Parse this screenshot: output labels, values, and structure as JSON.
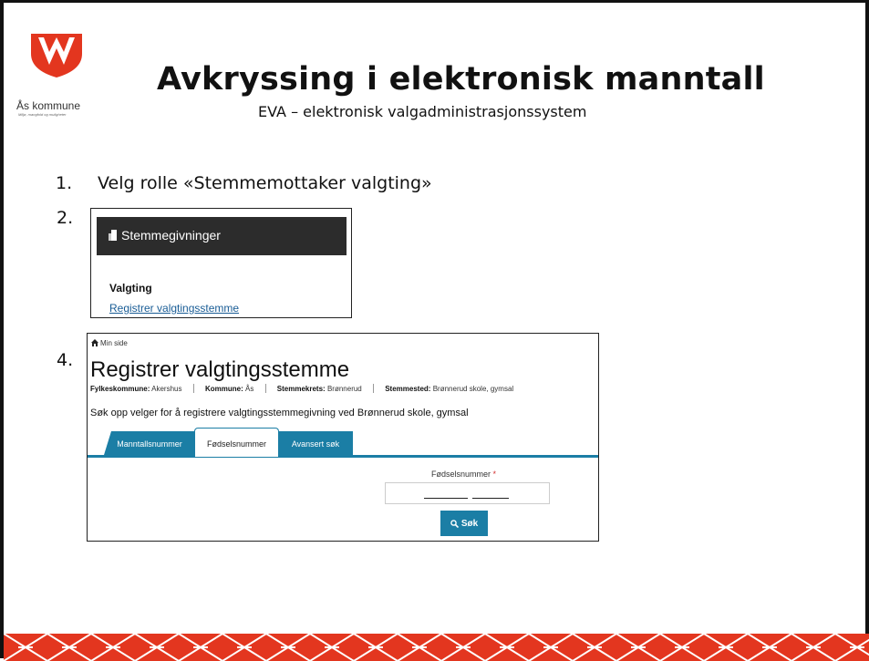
{
  "colors": {
    "accent": "#1b7ea5",
    "band": "#e3361f",
    "dark_bar": "#2c2c2c",
    "link": "#1a5d96"
  },
  "logo": {
    "name": "Ås kommune",
    "tagline": "Miljø, mangfold og muligheter",
    "icon": "coat-of-arms-icon"
  },
  "header": {
    "title": "Avkryssing i elektronisk manntall",
    "subtitle": "EVA – elektronisk valgadministrasjonssystem"
  },
  "steps": {
    "step1": {
      "number": "1.",
      "text": "Velg rolle «Stemmemottaker valgting»"
    },
    "step2": {
      "number": "2."
    },
    "step4": {
      "number": "4."
    }
  },
  "screenshot2": {
    "bar_title": "Stemmegivninger",
    "bar_icon": "ballot-icon",
    "section": "Valgting",
    "link": "Registrer valgtingsstemme"
  },
  "screenshot4": {
    "breadcrumb": "Min side",
    "breadcrumb_icon": "home-icon",
    "page_title": "Registrer valgtingsstemme",
    "meta": {
      "fylke_label": "Fylkeskommune:",
      "fylke_value": "Akershus",
      "kommune_label": "Kommune:",
      "kommune_value": "Ås",
      "krets_label": "Stemmekrets:",
      "krets_value": "Brønnerud",
      "sted_label": "Stemmested:",
      "sted_value": "Brønnerud skole, gymsal"
    },
    "search_description": "Søk opp velger for å registrere valgtingsstemmegivning ved Brønnerud skole, gymsal",
    "tabs": [
      "Manntallsnummer",
      "Fødselsnummer",
      "Avansert søk"
    ],
    "active_tab": "Fødselsnummer",
    "field_label": "Fødselsnummer",
    "required_marker": "*",
    "search_button": "Søk",
    "search_icon": "search-icon"
  }
}
